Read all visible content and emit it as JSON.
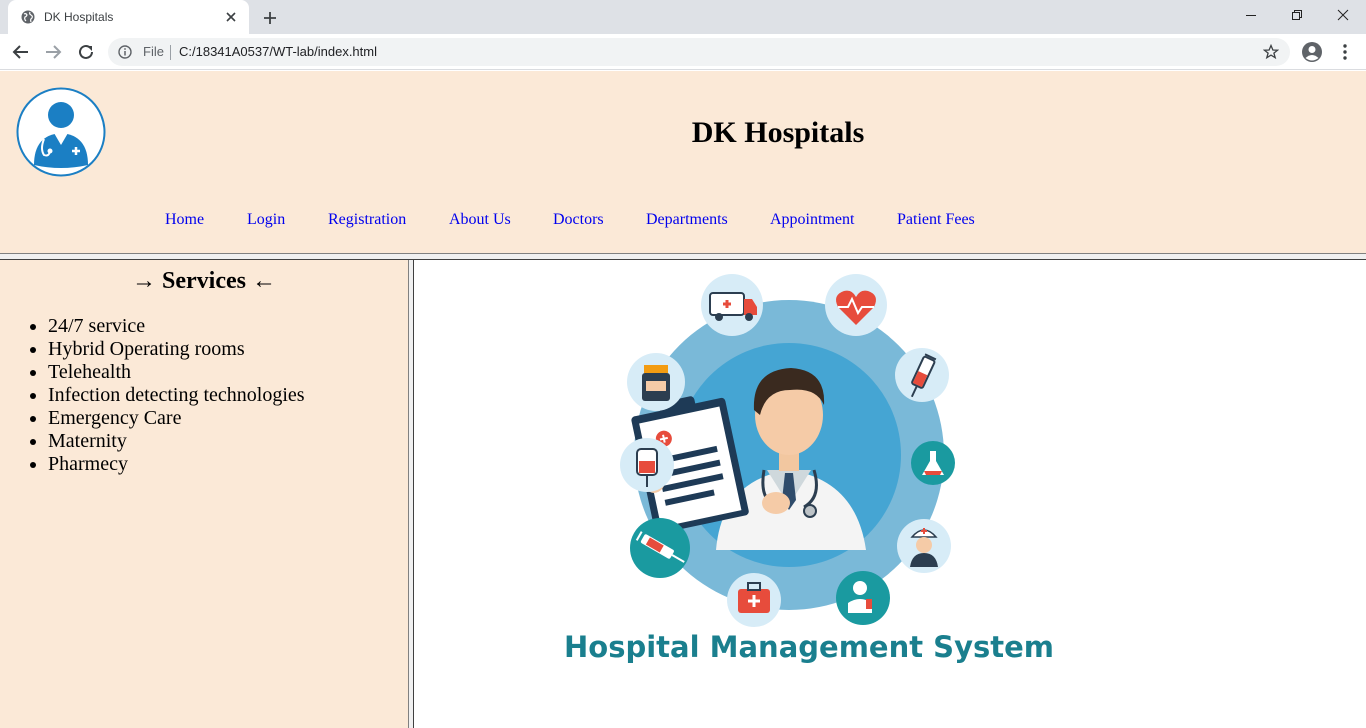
{
  "browser": {
    "tab_title": "DK Hospitals",
    "url_scheme": "File",
    "url": "C:/18341A0537/WT-lab/index.html",
    "icons": [
      "globe-icon",
      "close-icon",
      "plus-icon",
      "minimize-icon",
      "restore-icon",
      "back-icon",
      "forward-icon",
      "reload-icon",
      "info-icon",
      "star-icon",
      "profile-icon",
      "more-icon"
    ]
  },
  "header": {
    "title": "DK Hospitals",
    "logo_icon": "doctor-avatar-icon",
    "nav": [
      "Home",
      "Login",
      "Registration",
      "About Us",
      "Doctors",
      "Departments",
      "Appointment",
      "Patient Fees"
    ]
  },
  "services": {
    "heading": "→ Services ←",
    "items": [
      "24/7 service",
      "Hybrid Operating rooms",
      "Telehealth",
      "Infection detecting technologies",
      "Emergency Care",
      "Maternity",
      "Pharmecy"
    ]
  },
  "main": {
    "hero_caption": "Hospital Management System",
    "hero_icons": [
      "ambulance-icon",
      "heart-rate-icon",
      "medicine-bottle-icon",
      "syringe-icon",
      "iv-bag-icon",
      "flask-icon",
      "injection-icon",
      "nurse-icon",
      "first-aid-kit-icon",
      "patient-icon",
      "doctor-clipboard-icon"
    ]
  },
  "colors": {
    "page_bg": "#fbe9d7",
    "link": "#0000ee",
    "caption": "#1a7f8e",
    "logo_blue": "#1b7fc4"
  }
}
